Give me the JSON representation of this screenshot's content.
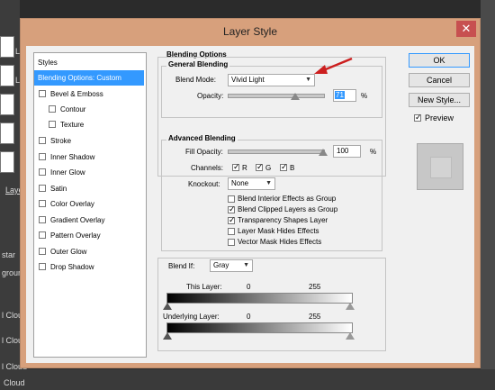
{
  "background": {
    "left_items": [
      "L",
      "L",
      "Laye",
      "star",
      "groun",
      "l Cloud",
      "l Cloud",
      "l Cloud",
      "Cloud"
    ]
  },
  "dialog": {
    "title": "Layer Style",
    "close_glyph": "✕"
  },
  "styles_list": {
    "header": "Styles",
    "selected_item": "Blending Options: Custom",
    "items": [
      {
        "label": "Bevel & Emboss",
        "checked": false
      },
      {
        "label": "Contour",
        "checked": false
      },
      {
        "label": "Texture",
        "checked": false
      },
      {
        "label": "Stroke",
        "checked": false
      },
      {
        "label": "Inner Shadow",
        "checked": false
      },
      {
        "label": "Inner Glow",
        "checked": false
      },
      {
        "label": "Satin",
        "checked": false
      },
      {
        "label": "Color Overlay",
        "checked": false
      },
      {
        "label": "Gradient Overlay",
        "checked": false
      },
      {
        "label": "Pattern Overlay",
        "checked": false
      },
      {
        "label": "Outer Glow",
        "checked": false
      },
      {
        "label": "Drop Shadow",
        "checked": false
      }
    ]
  },
  "blending": {
    "section_title": "Blending Options",
    "general": {
      "title": "General Blending",
      "blend_mode_label": "Blend Mode:",
      "blend_mode_value": "Vivid Light",
      "opacity_label": "Opacity:",
      "opacity_value": "71",
      "opacity_unit": "%",
      "opacity_level": 0.71
    },
    "advanced": {
      "title": "Advanced Blending",
      "fill_opacity_label": "Fill Opacity:",
      "fill_opacity_value": "100",
      "fill_opacity_unit": "%",
      "fill_opacity_level": 1.0,
      "channels_label": "Channels:",
      "channel_r": "R",
      "channel_g": "G",
      "channel_b": "B",
      "knockout_label": "Knockout:",
      "knockout_value": "None",
      "options": [
        {
          "label": "Blend Interior Effects as Group",
          "checked": false
        },
        {
          "label": "Blend Clipped Layers as Group",
          "checked": true
        },
        {
          "label": "Transparency Shapes Layer",
          "checked": true
        },
        {
          "label": "Layer Mask Hides Effects",
          "checked": false
        },
        {
          "label": "Vector Mask Hides Effects",
          "checked": false
        }
      ]
    },
    "blend_if": {
      "label": "Blend If:",
      "value": "Gray",
      "this_layer_label": "This Layer:",
      "this_layer_min": "0",
      "this_layer_max": "255",
      "underlying_label": "Underlying Layer:",
      "underlying_min": "0",
      "underlying_max": "255"
    }
  },
  "buttons": {
    "ok": "OK",
    "cancel": "Cancel",
    "new_style": "New Style...",
    "preview_label": "Preview"
  },
  "colors": {
    "dialog_frame": "#d7a07c",
    "selection": "#3399ff",
    "annotation_arrow": "#cc1f1f"
  }
}
